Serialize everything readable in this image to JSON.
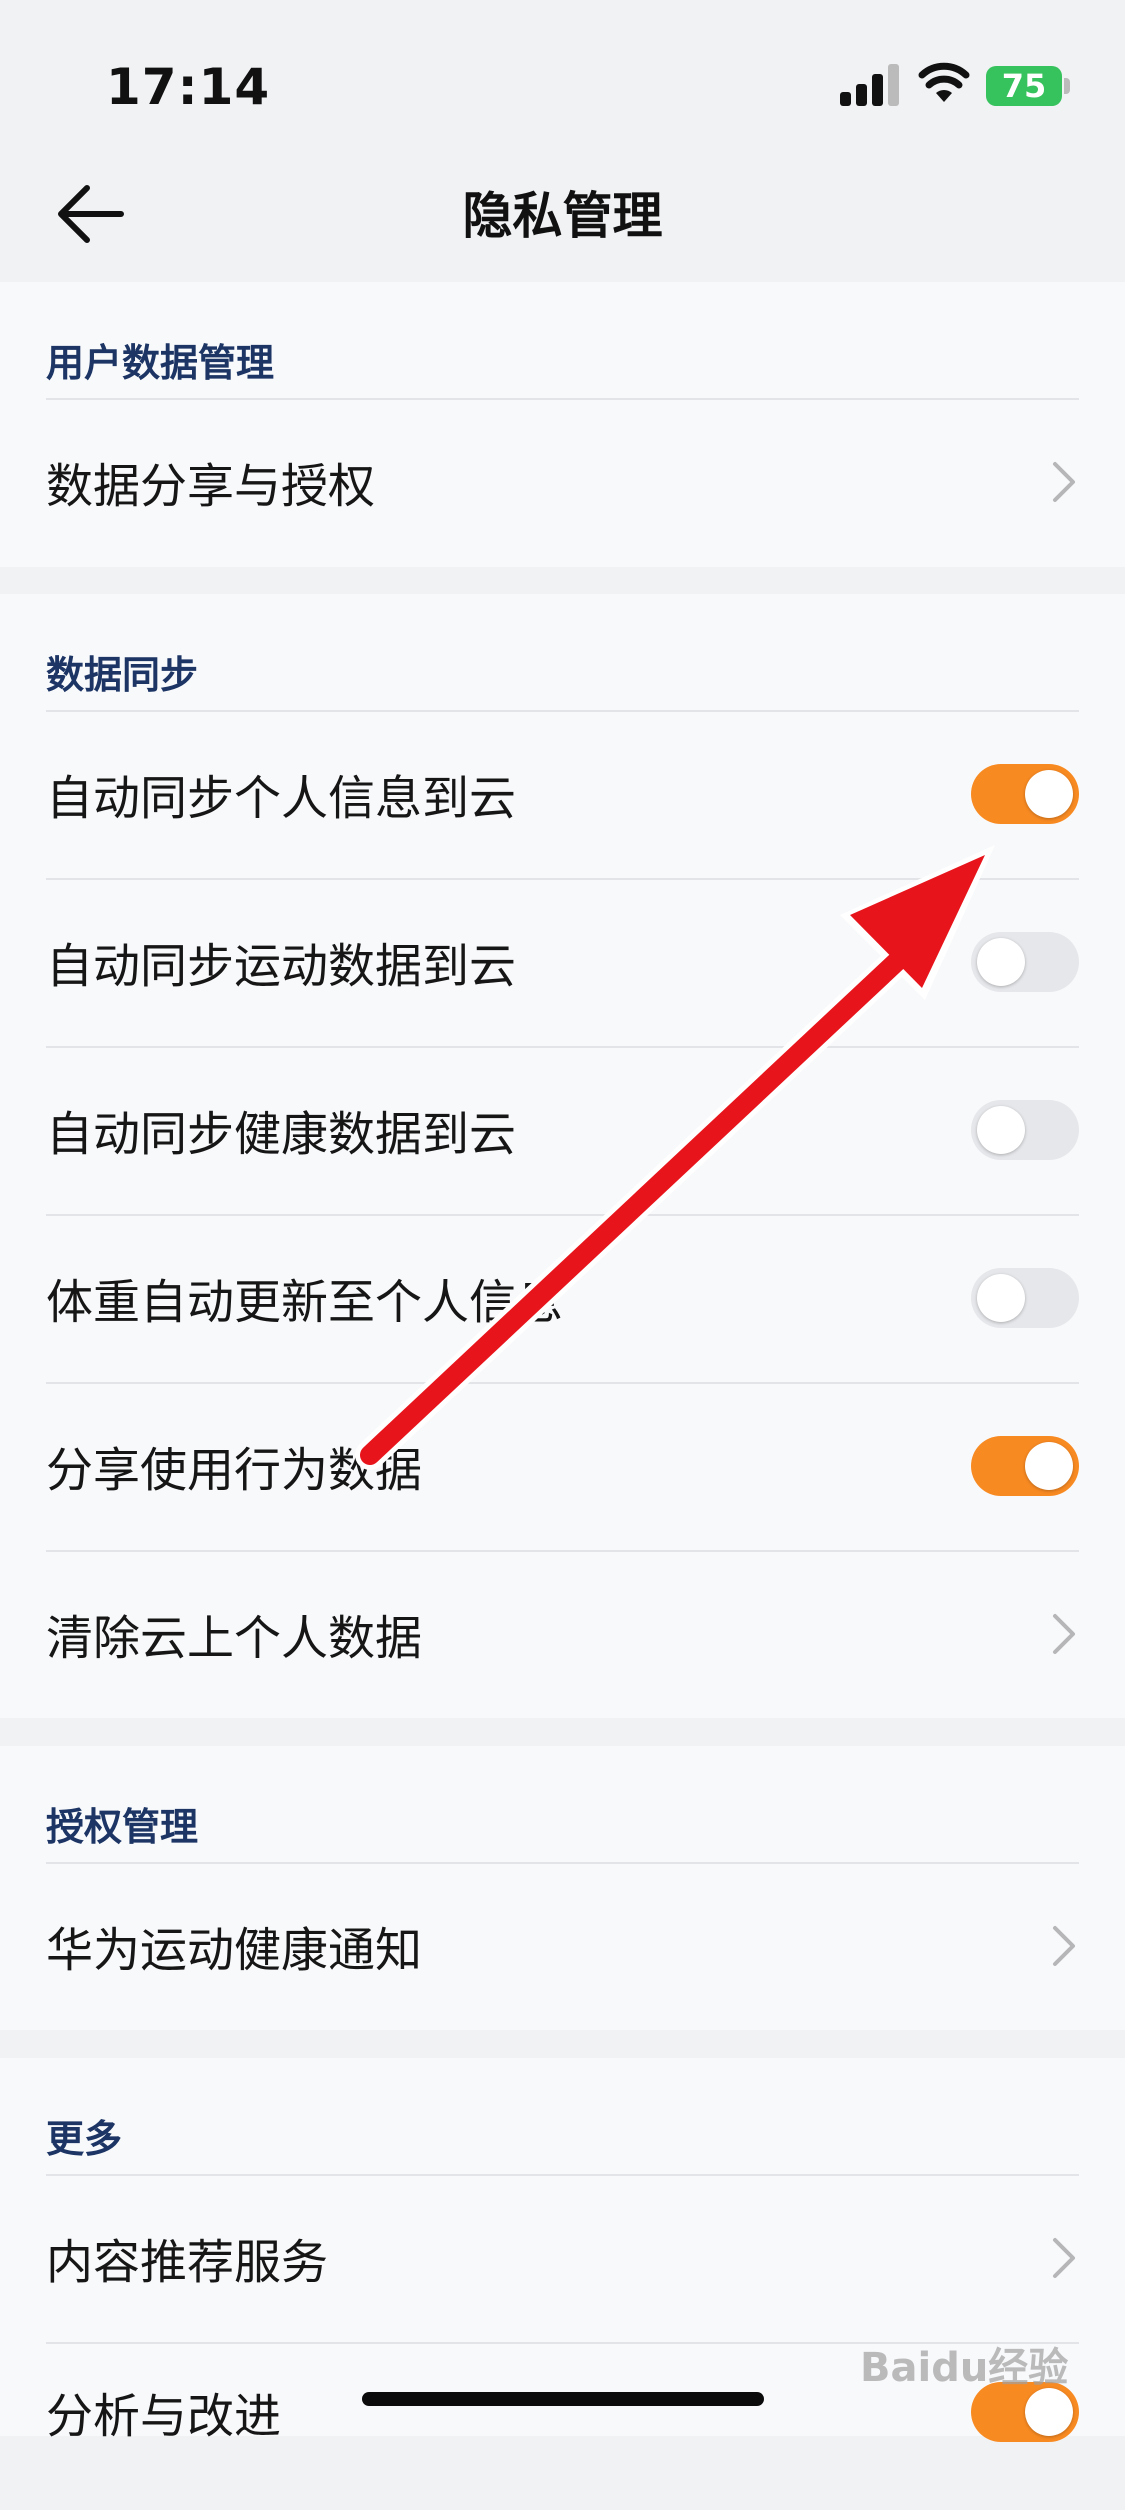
{
  "status_bar": {
    "time": "17:14",
    "battery": "75"
  },
  "header": {
    "title": "隐私管理"
  },
  "sections": [
    {
      "title": "用户数据管理",
      "items": [
        {
          "label": "数据分享与授权"
        }
      ]
    },
    {
      "title": "数据同步",
      "items": [
        {
          "label": "自动同步个人信息到云",
          "toggle": true
        },
        {
          "label": "自动同步运动数据到云",
          "toggle": false
        },
        {
          "label": "自动同步健康数据到云",
          "toggle": false
        },
        {
          "label": "体重自动更新至个人信息",
          "toggle": false
        },
        {
          "label": "分享使用行为数据",
          "toggle": true
        },
        {
          "label": "清除云上个人数据"
        }
      ]
    },
    {
      "title": "授权管理",
      "items": [
        {
          "label": "华为运动健康通知"
        }
      ]
    },
    {
      "title": "更多",
      "items": [
        {
          "label": "内容推荐服务"
        },
        {
          "label": "分析与改进",
          "toggle": true
        }
      ]
    }
  ],
  "watermark": "Baidu经验",
  "colors": {
    "toggle_on": "#f88a22",
    "toggle_off": "#e6e7ea",
    "section_title": "#1c3564",
    "arrow": "#e8141b"
  },
  "icons": [
    "back-arrow-icon",
    "chevron-right-icon",
    "cellular-signal-icon",
    "wifi-icon",
    "battery-icon"
  ]
}
